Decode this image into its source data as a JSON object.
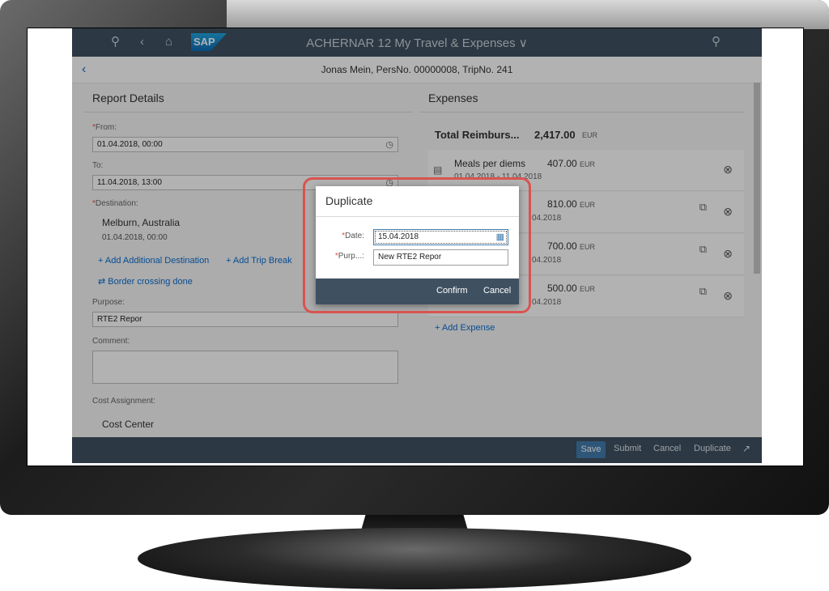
{
  "shell": {
    "title": "ACHERNAR 12 My Travel & Expenses ∨",
    "logo": "SAP",
    "icons": [
      "user-icon",
      "back-icon",
      "home-icon",
      "search-icon"
    ]
  },
  "subheader": {
    "title": "Jonas Mein, PersNo. 00000008, TripNo. 241"
  },
  "report": {
    "title": "Report Details",
    "from_label": "From:",
    "from_value": "01.04.2018, 00:00",
    "to_label": "To:",
    "to_value": "11.04.2018, 13:00",
    "destination_label": "Destination:",
    "destination_name": "Melburn, Australia",
    "destination_date": "01.04.2018, 00:00",
    "add_destination": "Add Additional Destination",
    "add_trip_break": "Add Trip Break",
    "border_crossing": "Border crossing done",
    "purpose_label": "Purpose:",
    "purpose_value": "RTE2 Repor",
    "comment_label": "Comment:",
    "cost_label": "Cost Assignment:",
    "cost_center": "Cost Center"
  },
  "expenses": {
    "title": "Expenses",
    "total_label": "Total Reimburs...",
    "total_amount": "2,417.00",
    "currency": "EUR",
    "items": [
      {
        "name": "Meals per diems",
        "amount": "407.00",
        "date": "01.04.2018 - 11.04.2018"
      },
      {
        "name": "",
        "amount": "810.00",
        "date": "04.2018"
      },
      {
        "name": "",
        "amount": "700.00",
        "date": "04.2018"
      },
      {
        "name": "",
        "amount": "500.00",
        "date": "04.2018"
      }
    ],
    "add_expense": "Add Expense"
  },
  "footer": {
    "save": "Save",
    "submit": "Submit",
    "cancel": "Cancel",
    "duplicate": "Duplicate"
  },
  "dialog": {
    "title": "Duplicate",
    "date_label": "Date:",
    "date_value": "15.04.2018",
    "purpose_label": "Purp...:",
    "purpose_value": "New RTE2 Repor",
    "confirm": "Confirm",
    "cancel": "Cancel"
  },
  "colors": {
    "shell": "#3f5161",
    "accent": "#0a6ed1",
    "save_button": "#427cac",
    "highlight": "#d9534f"
  }
}
